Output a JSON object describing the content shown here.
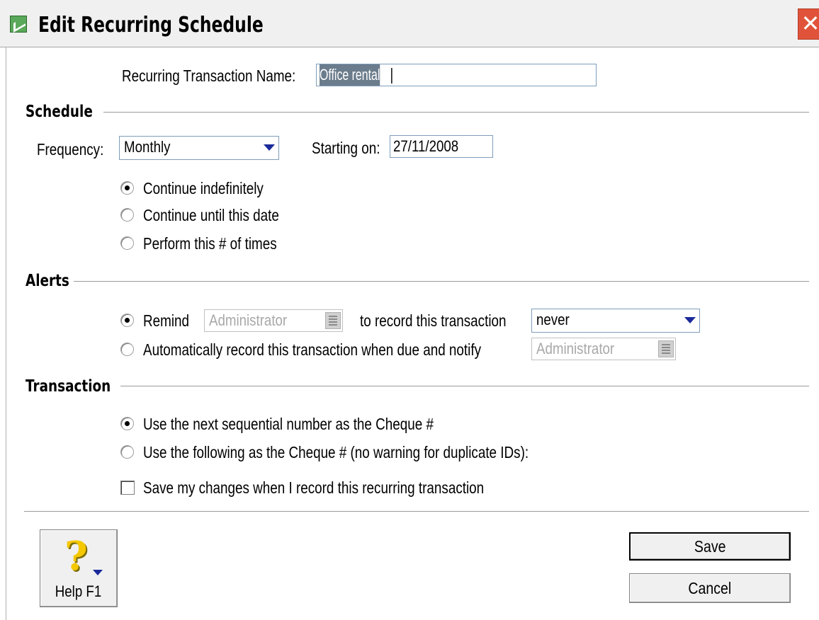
{
  "window": {
    "title": "Edit Recurring Schedule",
    "close_glyph": "✕"
  },
  "name_field": {
    "label": "Recurring Transaction Name:",
    "value": "Office rental"
  },
  "schedule": {
    "heading": "Schedule",
    "frequency_label": "Frequency:",
    "frequency_value": "Monthly",
    "starting_label": "Starting on:",
    "starting_value": "27/11/2008",
    "options": [
      {
        "label": "Continue indefinitely",
        "selected": true
      },
      {
        "label": "Continue until this date",
        "selected": false
      },
      {
        "label": "Perform this # of times",
        "selected": false
      }
    ]
  },
  "alerts": {
    "heading": "Alerts",
    "remind_label": "Remind",
    "remind_user": "Administrator",
    "record_label": "to record this transaction",
    "record_when": "never",
    "auto_label": "Automatically record this transaction when due and notify",
    "auto_user": "Administrator"
  },
  "transaction": {
    "heading": "Transaction",
    "opt_next": "Use the next sequential number as the Cheque #",
    "opt_following": "Use the following as the Cheque # (no warning for duplicate IDs):",
    "save_changes": "Save my changes when I record this recurring transaction",
    "save_changes_checked": false
  },
  "buttons": {
    "help": "Help F1",
    "save": "Save",
    "cancel": "Cancel"
  },
  "colors": {
    "accent": "#1a2a9a",
    "close": "#e0533a",
    "selection": "#6b7c8c"
  }
}
